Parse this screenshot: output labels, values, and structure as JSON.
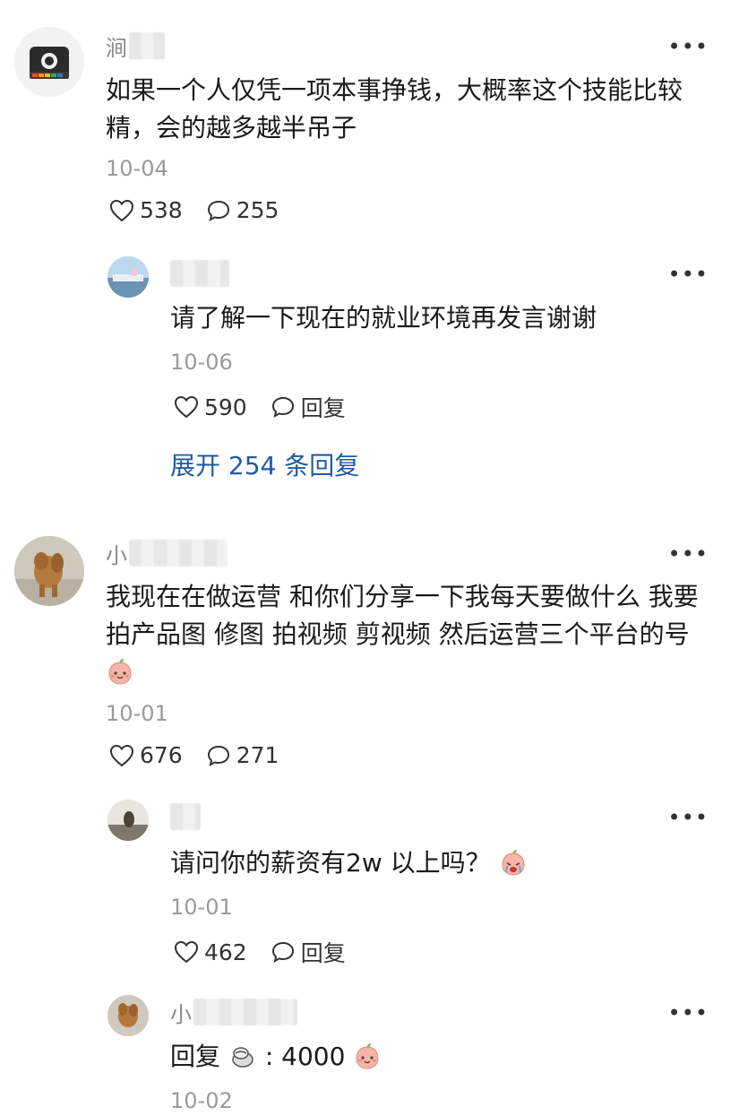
{
  "comments": [
    {
      "name_visible": "涧",
      "text": "如果一个人仅凭一项本事挣钱，大概率这个技能比较精，会的越多越半吊子",
      "date": "10-04",
      "likes": "538",
      "replies": "255",
      "replies_list": [
        {
          "name_visible": "",
          "text": "请了解一下现在的就业环境再发言谢谢",
          "date": "10-06",
          "likes": "590",
          "reply_label": "回复"
        }
      ],
      "expand_label": "展开 254 条回复"
    },
    {
      "name_visible": "小",
      "text": "我现在在做运营 和你们分享一下我每天要做什么 我要拍产品图 修图 拍视频 剪视频 然后运营三个平台的号",
      "date": "10-01",
      "likes": "676",
      "replies": "271",
      "replies_list": [
        {
          "name_visible": "",
          "text": "请问你的薪资有2w 以上吗？",
          "date": "10-01",
          "likes": "462",
          "reply_label": "回复"
        },
        {
          "name_visible": "小",
          "text_prefix": "回复",
          "text_suffix": ": 4000",
          "date": "10-02"
        }
      ]
    }
  ],
  "icons": {
    "more": "more-dots-icon",
    "like": "heart-icon",
    "comment": "comment-bubble-icon"
  },
  "colors": {
    "link": "#1f5aa8",
    "meta": "#9a9a9a"
  }
}
